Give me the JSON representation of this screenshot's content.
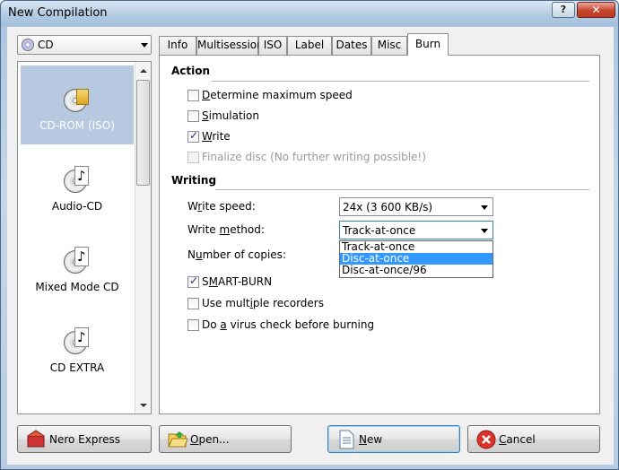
{
  "window": {
    "title": "New Compilation",
    "help_glyph": "?",
    "close_glyph": "✕"
  },
  "disc_type": {
    "selected": "CD"
  },
  "sidebar": {
    "items": [
      {
        "label": "CD-ROM (ISO)",
        "selected": true,
        "icon": "cd-rom-iso-icon"
      },
      {
        "label": "Audio-CD",
        "selected": false,
        "icon": "audio-cd-icon"
      },
      {
        "label": "Mixed Mode CD",
        "selected": false,
        "icon": "mixed-mode-cd-icon"
      },
      {
        "label": "CD EXTRA",
        "selected": false,
        "icon": "cd-extra-icon"
      }
    ]
  },
  "tabs": [
    {
      "label": "Info"
    },
    {
      "label": "Multisession"
    },
    {
      "label": "ISO"
    },
    {
      "label": "Label"
    },
    {
      "label": "Dates"
    },
    {
      "label": "Misc"
    },
    {
      "label": "Burn",
      "active": true
    }
  ],
  "action": {
    "title": "Action",
    "determine_speed": {
      "label_u": "D",
      "label_rest": "etermine maximum speed",
      "checked": false
    },
    "simulation": {
      "label_u": "S",
      "label_rest": "imulation",
      "checked": false
    },
    "write": {
      "label_u": "W",
      "label_rest": "rite",
      "checked": true
    },
    "finalize": {
      "label": "Finalize disc (No further writing possible!)",
      "checked": false,
      "disabled": true
    }
  },
  "writing": {
    "title": "Writing",
    "speed_label_pre": "W",
    "speed_label_u": "r",
    "speed_label_post": "ite speed:",
    "speed_value": "24x (3 600 KB/s)",
    "method_label_pre": "Write ",
    "method_label_u": "m",
    "method_label_post": "ethod:",
    "method_value": "Track-at-once",
    "method_options": [
      "Track-at-once",
      "Disc-at-once",
      "Disc-at-once/96"
    ],
    "method_highlighted": "Disc-at-once",
    "copies_label_pre": "N",
    "copies_label_u": "u",
    "copies_label_post": "mber of copies:",
    "smart_burn": {
      "label_pre": "S",
      "label_u": "M",
      "label_post": "ART-BURN",
      "checked": true
    },
    "multiple_recorders": {
      "label_pre": "Use mult",
      "label_u": "i",
      "label_post": "ple recorders",
      "checked": false
    },
    "virus_check": {
      "label_pre": "Do ",
      "label_u": "a",
      "label_post": " virus check before burning",
      "checked": false
    }
  },
  "buttons": {
    "nero_express": "Nero Express",
    "open_u": "O",
    "open_rest": "pen...",
    "new_u": "N",
    "new_rest": "ew",
    "cancel_u": "C",
    "cancel_rest": "ancel"
  },
  "colors": {
    "selection": "#3399ff",
    "sidebar_selected": "#b6c9e0"
  }
}
